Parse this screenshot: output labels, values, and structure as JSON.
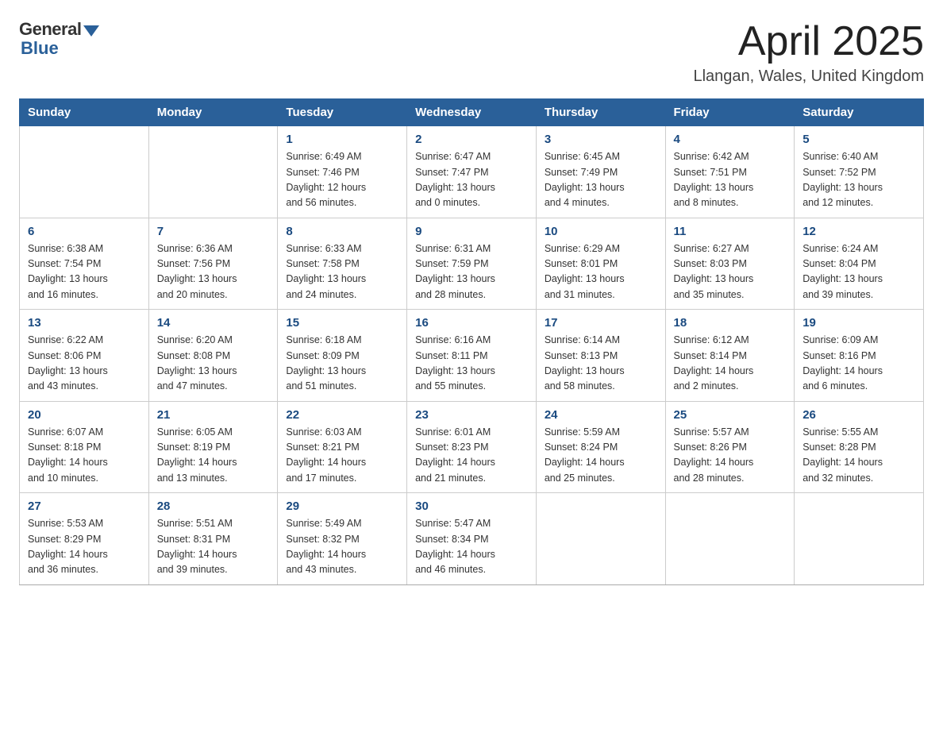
{
  "header": {
    "logo_general": "General",
    "logo_blue": "Blue",
    "month_title": "April 2025",
    "location": "Llangan, Wales, United Kingdom"
  },
  "days_of_week": [
    "Sunday",
    "Monday",
    "Tuesday",
    "Wednesday",
    "Thursday",
    "Friday",
    "Saturday"
  ],
  "weeks": [
    [
      {
        "day": "",
        "info": ""
      },
      {
        "day": "",
        "info": ""
      },
      {
        "day": "1",
        "info": "Sunrise: 6:49 AM\nSunset: 7:46 PM\nDaylight: 12 hours\nand 56 minutes."
      },
      {
        "day": "2",
        "info": "Sunrise: 6:47 AM\nSunset: 7:47 PM\nDaylight: 13 hours\nand 0 minutes."
      },
      {
        "day": "3",
        "info": "Sunrise: 6:45 AM\nSunset: 7:49 PM\nDaylight: 13 hours\nand 4 minutes."
      },
      {
        "day": "4",
        "info": "Sunrise: 6:42 AM\nSunset: 7:51 PM\nDaylight: 13 hours\nand 8 minutes."
      },
      {
        "day": "5",
        "info": "Sunrise: 6:40 AM\nSunset: 7:52 PM\nDaylight: 13 hours\nand 12 minutes."
      }
    ],
    [
      {
        "day": "6",
        "info": "Sunrise: 6:38 AM\nSunset: 7:54 PM\nDaylight: 13 hours\nand 16 minutes."
      },
      {
        "day": "7",
        "info": "Sunrise: 6:36 AM\nSunset: 7:56 PM\nDaylight: 13 hours\nand 20 minutes."
      },
      {
        "day": "8",
        "info": "Sunrise: 6:33 AM\nSunset: 7:58 PM\nDaylight: 13 hours\nand 24 minutes."
      },
      {
        "day": "9",
        "info": "Sunrise: 6:31 AM\nSunset: 7:59 PM\nDaylight: 13 hours\nand 28 minutes."
      },
      {
        "day": "10",
        "info": "Sunrise: 6:29 AM\nSunset: 8:01 PM\nDaylight: 13 hours\nand 31 minutes."
      },
      {
        "day": "11",
        "info": "Sunrise: 6:27 AM\nSunset: 8:03 PM\nDaylight: 13 hours\nand 35 minutes."
      },
      {
        "day": "12",
        "info": "Sunrise: 6:24 AM\nSunset: 8:04 PM\nDaylight: 13 hours\nand 39 minutes."
      }
    ],
    [
      {
        "day": "13",
        "info": "Sunrise: 6:22 AM\nSunset: 8:06 PM\nDaylight: 13 hours\nand 43 minutes."
      },
      {
        "day": "14",
        "info": "Sunrise: 6:20 AM\nSunset: 8:08 PM\nDaylight: 13 hours\nand 47 minutes."
      },
      {
        "day": "15",
        "info": "Sunrise: 6:18 AM\nSunset: 8:09 PM\nDaylight: 13 hours\nand 51 minutes."
      },
      {
        "day": "16",
        "info": "Sunrise: 6:16 AM\nSunset: 8:11 PM\nDaylight: 13 hours\nand 55 minutes."
      },
      {
        "day": "17",
        "info": "Sunrise: 6:14 AM\nSunset: 8:13 PM\nDaylight: 13 hours\nand 58 minutes."
      },
      {
        "day": "18",
        "info": "Sunrise: 6:12 AM\nSunset: 8:14 PM\nDaylight: 14 hours\nand 2 minutes."
      },
      {
        "day": "19",
        "info": "Sunrise: 6:09 AM\nSunset: 8:16 PM\nDaylight: 14 hours\nand 6 minutes."
      }
    ],
    [
      {
        "day": "20",
        "info": "Sunrise: 6:07 AM\nSunset: 8:18 PM\nDaylight: 14 hours\nand 10 minutes."
      },
      {
        "day": "21",
        "info": "Sunrise: 6:05 AM\nSunset: 8:19 PM\nDaylight: 14 hours\nand 13 minutes."
      },
      {
        "day": "22",
        "info": "Sunrise: 6:03 AM\nSunset: 8:21 PM\nDaylight: 14 hours\nand 17 minutes."
      },
      {
        "day": "23",
        "info": "Sunrise: 6:01 AM\nSunset: 8:23 PM\nDaylight: 14 hours\nand 21 minutes."
      },
      {
        "day": "24",
        "info": "Sunrise: 5:59 AM\nSunset: 8:24 PM\nDaylight: 14 hours\nand 25 minutes."
      },
      {
        "day": "25",
        "info": "Sunrise: 5:57 AM\nSunset: 8:26 PM\nDaylight: 14 hours\nand 28 minutes."
      },
      {
        "day": "26",
        "info": "Sunrise: 5:55 AM\nSunset: 8:28 PM\nDaylight: 14 hours\nand 32 minutes."
      }
    ],
    [
      {
        "day": "27",
        "info": "Sunrise: 5:53 AM\nSunset: 8:29 PM\nDaylight: 14 hours\nand 36 minutes."
      },
      {
        "day": "28",
        "info": "Sunrise: 5:51 AM\nSunset: 8:31 PM\nDaylight: 14 hours\nand 39 minutes."
      },
      {
        "day": "29",
        "info": "Sunrise: 5:49 AM\nSunset: 8:32 PM\nDaylight: 14 hours\nand 43 minutes."
      },
      {
        "day": "30",
        "info": "Sunrise: 5:47 AM\nSunset: 8:34 PM\nDaylight: 14 hours\nand 46 minutes."
      },
      {
        "day": "",
        "info": ""
      },
      {
        "day": "",
        "info": ""
      },
      {
        "day": "",
        "info": ""
      }
    ]
  ]
}
